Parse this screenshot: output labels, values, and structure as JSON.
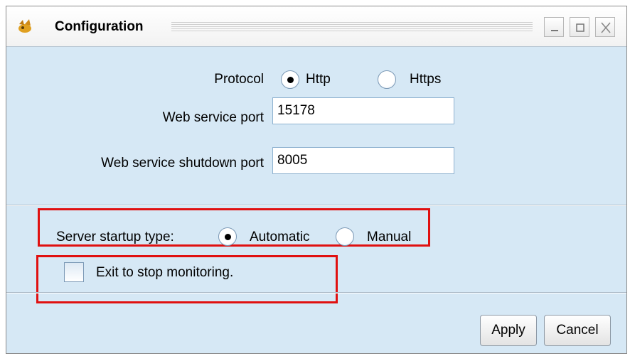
{
  "window": {
    "title": "Configuration"
  },
  "protocol": {
    "label": "Protocol",
    "options": [
      {
        "label": "Http",
        "selected": true
      },
      {
        "label": "Https",
        "selected": false
      }
    ]
  },
  "web_service_port": {
    "label": "Web service port",
    "value": "15178"
  },
  "shutdown_port": {
    "label": "Web service shutdown port",
    "value": "8005"
  },
  "startup": {
    "label": "Server startup type:",
    "options": [
      {
        "label": "Automatic",
        "selected": true
      },
      {
        "label": "Manual",
        "selected": false
      }
    ]
  },
  "exit_option": {
    "label": "Exit to stop monitoring.",
    "checked": false
  },
  "buttons": {
    "apply": "Apply",
    "cancel": "Cancel"
  },
  "colors": {
    "panel_bg": "#d6e8f5",
    "highlight": "#e01010"
  }
}
